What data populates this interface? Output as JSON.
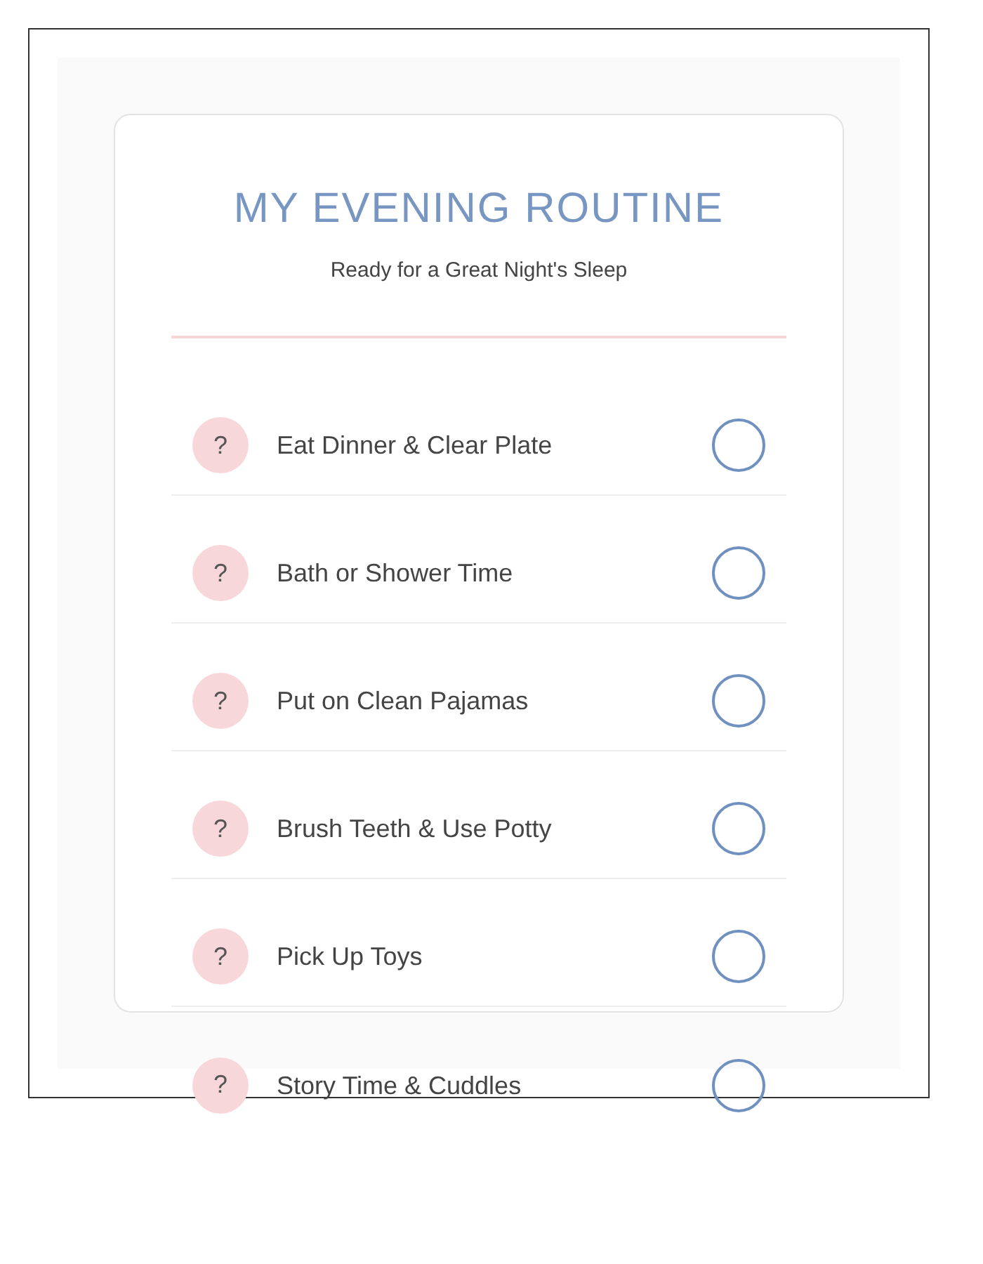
{
  "title": "MY EVENING ROUTINE",
  "subtitle": "Ready for a Great Night's Sleep",
  "tasks": [
    {
      "icon": "?",
      "label": "Eat Dinner & Clear Plate",
      "checked": false
    },
    {
      "icon": "?",
      "label": "Bath or Shower Time",
      "checked": false
    },
    {
      "icon": "?",
      "label": "Put on Clean Pajamas",
      "checked": false
    },
    {
      "icon": "?",
      "label": "Brush Teeth & Use Potty",
      "checked": false
    },
    {
      "icon": "?",
      "label": "Pick Up Toys",
      "checked": false
    },
    {
      "icon": "?",
      "label": "Story Time & Cuddles",
      "checked": false
    }
  ]
}
